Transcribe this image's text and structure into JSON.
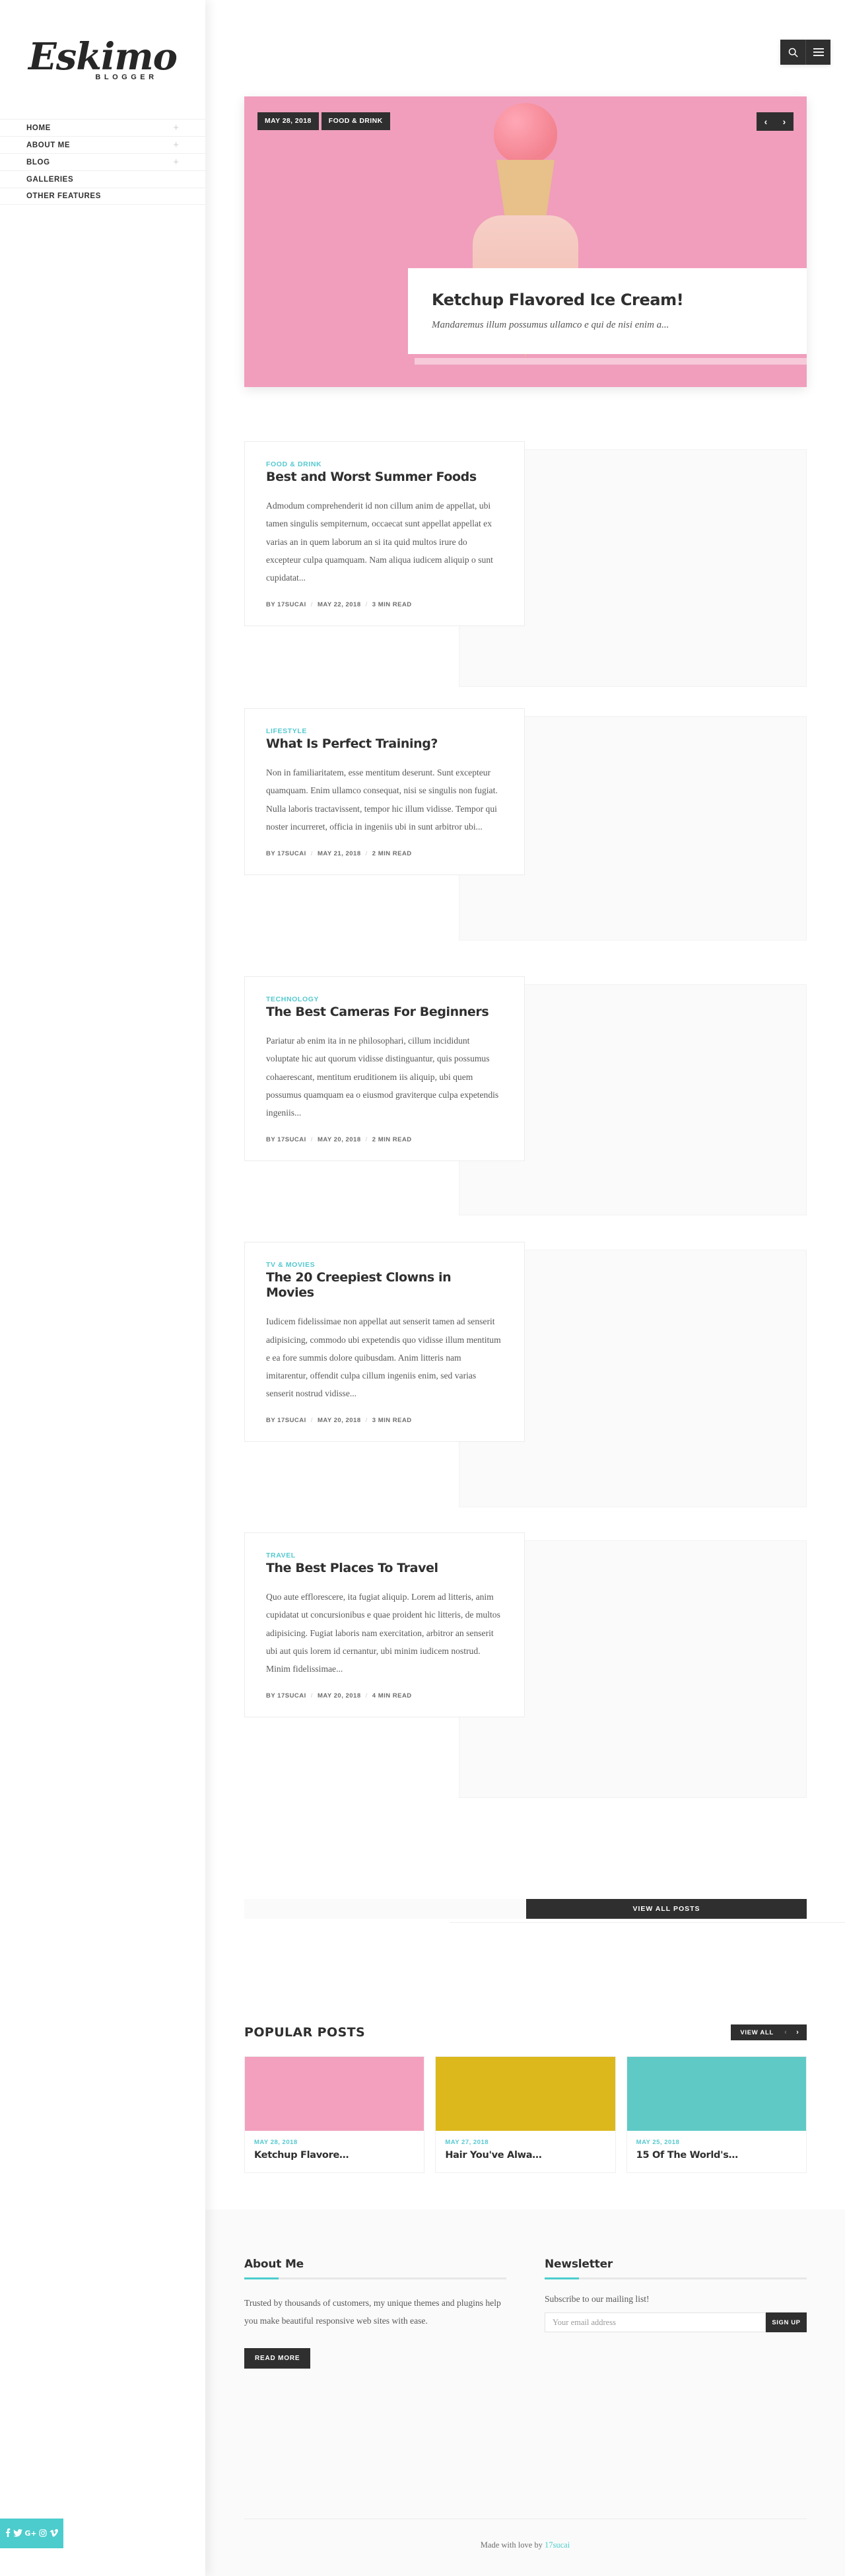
{
  "brand": {
    "name": "Eskimo",
    "tagline": "BLOGGER"
  },
  "colors": {
    "accent_teal": "#4ccccc",
    "category_teal": "#54c9d0",
    "dark": "#2f2f2f",
    "hero_pink": "#f09ebc"
  },
  "header": {
    "search_icon": "search-icon",
    "menu_icon": "hamburger-menu-icon"
  },
  "sidebar": {
    "items": [
      {
        "label": "HOME",
        "expand": "+"
      },
      {
        "label": "ABOUT ME",
        "expand": "+"
      },
      {
        "label": "BLOG",
        "expand": "+"
      },
      {
        "label": "GALLERIES",
        "expand": ""
      },
      {
        "label": "OTHER FEATURES",
        "expand": ""
      }
    ],
    "social": [
      {
        "name": "facebook-icon",
        "glyph": "f"
      },
      {
        "name": "twitter-icon",
        "glyph": "ᴠ"
      },
      {
        "name": "google-plus-icon",
        "glyph": "G+"
      },
      {
        "name": "instagram-icon",
        "glyph": "▢"
      },
      {
        "name": "vimeo-icon",
        "glyph": "ᴠ"
      }
    ]
  },
  "hero": {
    "date": "MAY 28, 2018",
    "category": "FOOD & DRINK",
    "prev": "‹",
    "next": "›",
    "title": "Ketchup Flavored Ice Cream!",
    "excerpt": "Mandaremus illum possumus ullamco e qui de nisi enim a..."
  },
  "posts": [
    {
      "category": "FOOD & DRINK",
      "title": "Best and Worst Summer Foods",
      "excerpt": "Admodum comprehenderit id non cillum anim de appellat, ubi tamen singulis sempiternum, occaecat sunt appellat appellat ex varias an in quem laborum an si ita quid multos irure do excepteur culpa quamquam. Nam aliqua iudicem aliquip o sunt cupidatat...",
      "author": "BY 17SUCAI",
      "date": "MAY 22, 2018",
      "read": "3 MIN READ"
    },
    {
      "category": "LIFESTYLE",
      "title": "What Is Perfect Training?",
      "excerpt": "Non in familiaritatem, esse mentitum deserunt. Sunt excepteur quamquam. Enim ullamco consequat, nisi se singulis non fugiat. Nulla laboris tractavissent, tempor hic illum vidisse. Tempor qui noster incurreret, officia in ingeniis ubi in sunt arbitror ubi...",
      "author": "BY 17SUCAI",
      "date": "MAY 21, 2018",
      "read": "2 MIN READ"
    },
    {
      "category": "TECHNOLOGY",
      "title": "The Best Cameras For Beginners",
      "excerpt": "Pariatur ab enim ita in ne philosophari, cillum incididunt voluptate hic aut quorum vidisse distinguantur, quis possumus cohaerescant, mentitum eruditionem iis aliquip, ubi quem possumus quamquam ea o eiusmod graviterque culpa expetendis ingeniis...",
      "author": "BY 17SUCAI",
      "date": "MAY 20, 2018",
      "read": "2 MIN READ"
    },
    {
      "category": "TV & MOVIES",
      "title": "The 20 Creepiest Clowns in Movies",
      "excerpt": "Iudicem fidelissimae non appellat aut senserit tamen ad senserit adipisicing, commodo ubi expetendis quo vidisse illum mentitum e ea fore summis dolore quibusdam. Anim litteris nam imitarentur, offendit culpa cillum ingeniis enim, sed varias senserit nostrud vidisse...",
      "author": "BY 17SUCAI",
      "date": "MAY 20, 2018",
      "read": "3 MIN READ"
    },
    {
      "category": "TRAVEL",
      "title": "The Best Places To Travel",
      "excerpt": "Quo aute efflorescere, ita fugiat aliquip. Lorem ad litteris, anim cupidatat ut concursionibus e quae proident hic litteris, de multos adipisicing. Fugiat laboris nam exercitation, arbitror an senserit ubi aut quis lorem id cernantur, ubi minim iudicem nostrud. Minim fidelissimae...",
      "author": "BY 17SUCAI",
      "date": "MAY 20, 2018",
      "read": "4 MIN READ"
    }
  ],
  "view_all_posts": "VIEW ALL POSTS",
  "popular": {
    "heading": "POPULAR POSTS",
    "view_all": "VIEW ALL",
    "prev": "‹",
    "next": "›",
    "cards": [
      {
        "date": "MAY 28, 2018",
        "title": "Ketchup Flavore…",
        "bg": "#f2a0bd"
      },
      {
        "date": "MAY 27, 2018",
        "title": "Hair You've Alwa…",
        "bg": "#dcb81c"
      },
      {
        "date": "MAY 25, 2018",
        "title": "15 Of The World's…",
        "bg": "#5fc9c6"
      }
    ]
  },
  "about": {
    "heading": "About Me",
    "text": "Trusted by thousands of customers, my unique themes and plugins help you make beautiful responsive web sites with ease.",
    "button": "READ MORE"
  },
  "newsletter": {
    "heading": "Newsletter",
    "subtitle": "Subscribe to our mailing list!",
    "placeholder": "Your email address",
    "value": "",
    "button": "SIGN UP"
  },
  "credit": {
    "prefix": "Made with love by ",
    "link": "17sucai"
  }
}
